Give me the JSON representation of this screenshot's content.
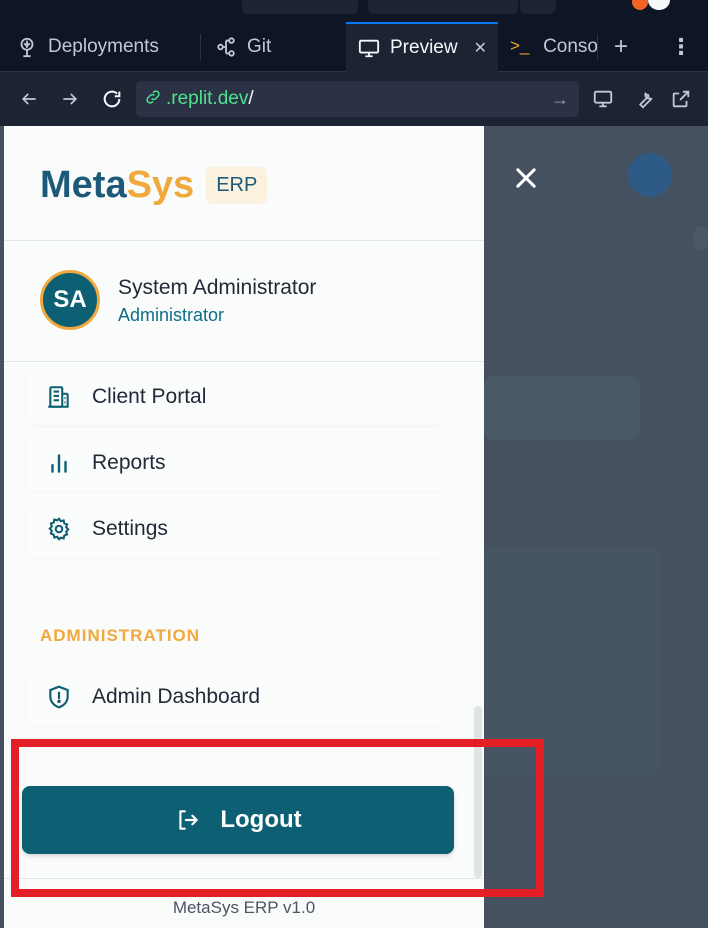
{
  "browser": {
    "tabs": [
      {
        "label": "Deployments",
        "icon": "deployments-icon",
        "active": false
      },
      {
        "label": "Git",
        "icon": "git-branch-icon",
        "active": false
      },
      {
        "label": "Preview",
        "icon": "monitor-icon",
        "active": true
      },
      {
        "label": "Conso",
        "icon": "console-icon",
        "active": false
      }
    ],
    "url_host": ".replit.dev",
    "url_path": "/"
  },
  "drawer": {
    "brand_meta": "Meta",
    "brand_sys": "Sys",
    "brand_badge": "ERP",
    "user": {
      "initials": "SA",
      "name": "System Administrator",
      "role": "Administrator"
    },
    "nav_items": [
      {
        "label": "Client Portal",
        "icon": "building-icon"
      },
      {
        "label": "Reports",
        "icon": "bar-chart-icon"
      },
      {
        "label": "Settings",
        "icon": "gear-icon"
      }
    ],
    "section_title": "ADMINISTRATION",
    "admin_items": [
      {
        "label": "Admin Dashboard",
        "icon": "shield-icon"
      }
    ],
    "logout_label": "Logout",
    "version": "MetaSys ERP v1.0"
  },
  "colors": {
    "brand_primary": "#1d5a79",
    "brand_accent": "#f0a93c",
    "button_bg": "#0d5f73",
    "highlight": "#e31e24"
  }
}
